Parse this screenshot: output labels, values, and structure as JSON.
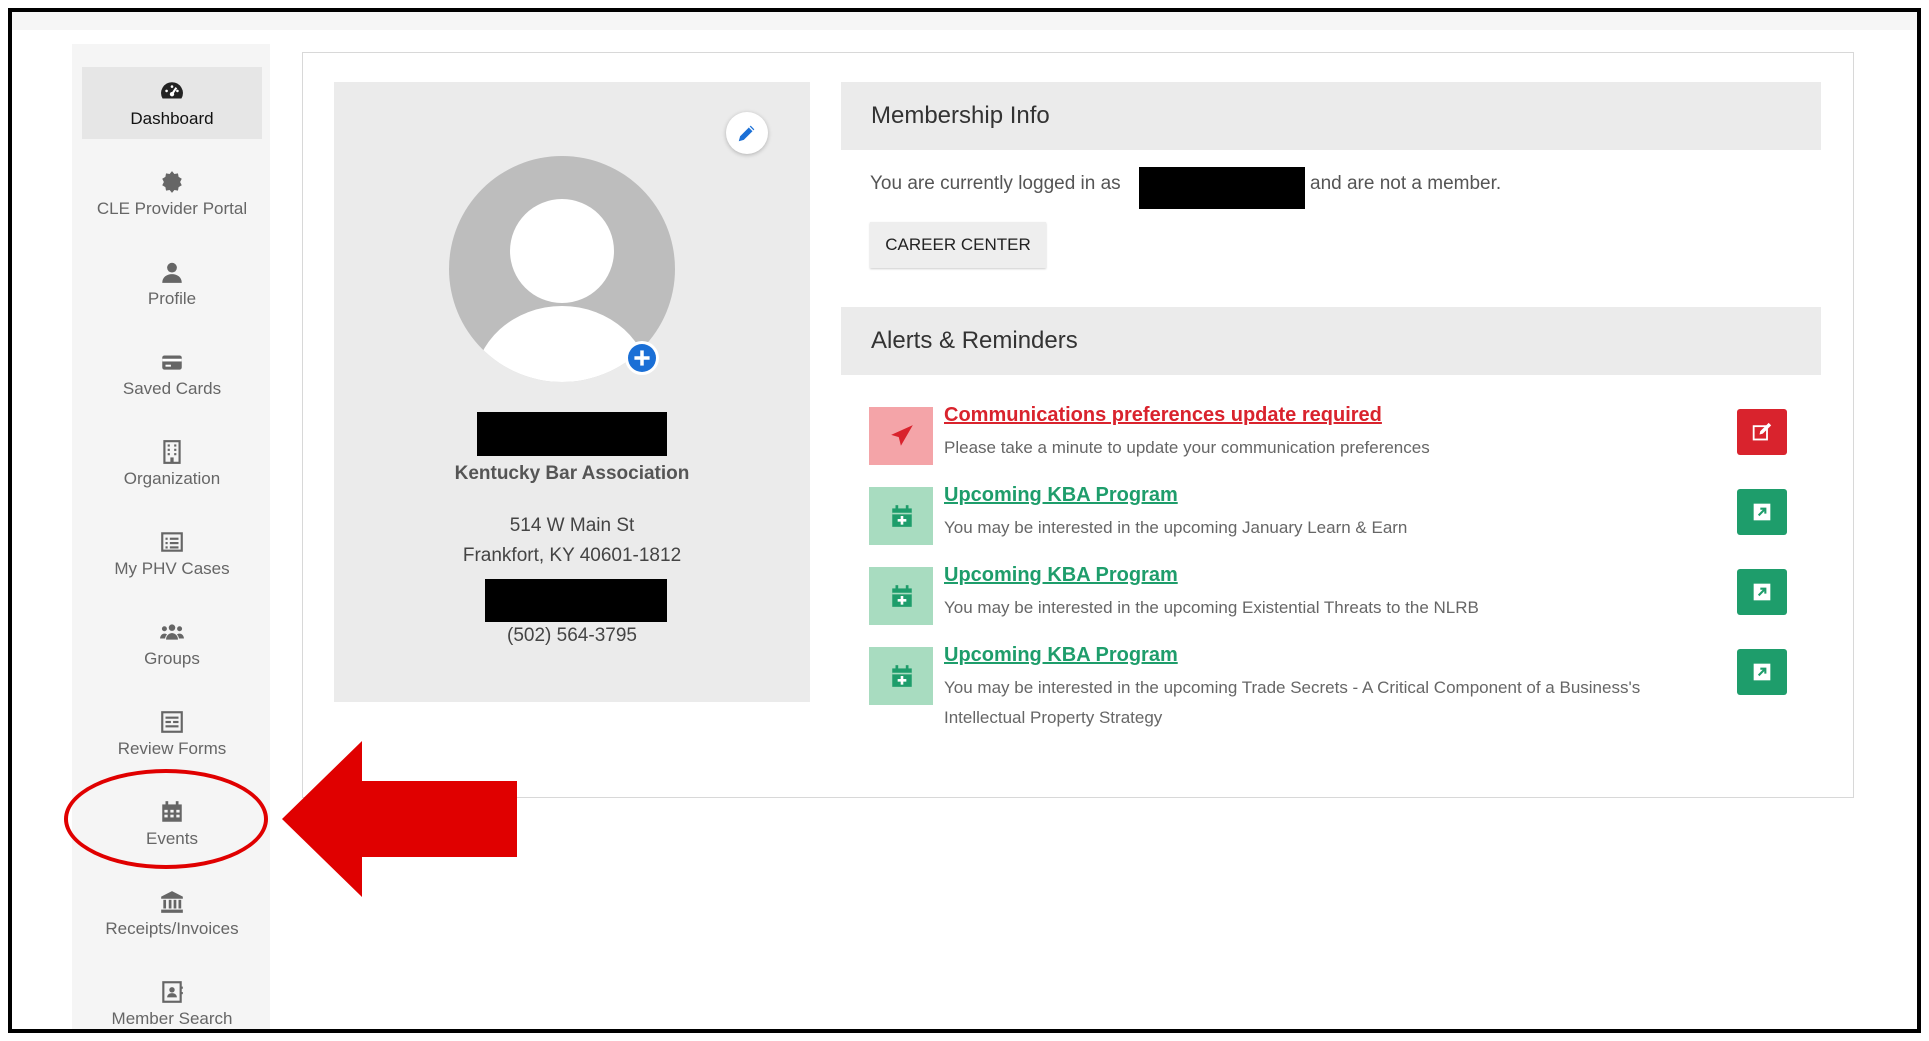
{
  "sidebar": {
    "items": [
      {
        "label": "Dashboard",
        "icon": "dashboard-gauge-icon",
        "active": true
      },
      {
        "label": "CLE Provider Portal",
        "icon": "badge-icon"
      },
      {
        "label": "Profile",
        "icon": "person-icon"
      },
      {
        "label": "Saved Cards",
        "icon": "credit-card-icon"
      },
      {
        "label": "Organization",
        "icon": "building-icon"
      },
      {
        "label": "My PHV Cases",
        "icon": "list-icon"
      },
      {
        "label": "Groups",
        "icon": "users-icon"
      },
      {
        "label": "Review Forms",
        "icon": "form-icon"
      },
      {
        "label": "Events",
        "icon": "calendar-icon"
      },
      {
        "label": "Receipts/Invoices",
        "icon": "bank-icon"
      },
      {
        "label": "Member Search",
        "icon": "contact-card-icon"
      }
    ]
  },
  "profile": {
    "organization": "Kentucky Bar Association",
    "address_line1": "514 W Main St",
    "address_line2": "Frankfort, KY 40601-1812",
    "phone": "(502) 564-3795"
  },
  "membership": {
    "title": "Membership Info",
    "logged_in_prefix": "You are currently logged in as",
    "logged_in_suffix": "and are not a member.",
    "career_button": "CAREER CENTER"
  },
  "alerts": {
    "title": "Alerts & Reminders",
    "items": [
      {
        "title": "Communications preferences update required",
        "description": "Please take a minute to update your communication preferences",
        "type": "warning",
        "icon": "paper-plane-icon",
        "action_icon": "edit-icon"
      },
      {
        "title": "Upcoming KBA Program",
        "description": "You may be interested in the upcoming January Learn & Earn",
        "type": "event",
        "icon": "calendar-plus-icon",
        "action_icon": "external-link-icon"
      },
      {
        "title": "Upcoming KBA Program",
        "description": "You may be interested in the upcoming Existential Threats to the NLRB",
        "type": "event",
        "icon": "calendar-plus-icon",
        "action_icon": "external-link-icon"
      },
      {
        "title": "Upcoming KBA Program",
        "description": "You may be interested in the upcoming Trade Secrets - A Critical Component of a Business's Intellectual Property Strategy",
        "type": "event",
        "icon": "calendar-plus-icon",
        "action_icon": "external-link-icon"
      }
    ]
  },
  "colors": {
    "warning_red": "#d9232d",
    "warning_bg": "#f4a4a8",
    "event_green": "#1e9d6b",
    "event_bg": "#a8dcc0",
    "accent_blue": "#1a6fd6",
    "callout_red": "#e00000"
  }
}
